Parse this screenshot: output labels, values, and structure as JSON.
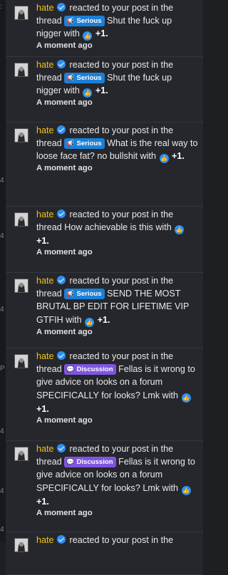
{
  "edge_chars": [
    ":",
    "4",
    "4",
    "4",
    "P",
    "4",
    "4",
    "4"
  ],
  "notifications": [
    {
      "user": "hate",
      "action": "reacted to your post in the thread",
      "tag": "Serious",
      "tag_type": "serious",
      "title": "Shut the fuck up nigger",
      "with": "with",
      "count": "+1.",
      "time": "A moment ago"
    },
    {
      "user": "hate",
      "action": "reacted to your post in the thread",
      "tag": "Serious",
      "tag_type": "serious",
      "title": "Shut the fuck up nigger",
      "with": "with",
      "count": "+1.",
      "time": "A moment ago"
    },
    {
      "user": "hate",
      "action": "reacted to your post in the thread",
      "tag": "Serious",
      "tag_type": "serious",
      "title": "What is the real way to loose face fat? no bullshit",
      "with": "with",
      "count": "+1.",
      "time": "A moment ago"
    },
    {
      "user": "hate",
      "action": "reacted to your post in the thread",
      "tag": "",
      "tag_type": "",
      "title": "How achievable is this",
      "with": "with",
      "count": "+1.",
      "time": "A moment ago"
    },
    {
      "user": "hate",
      "action": "reacted to your post in the thread",
      "tag": "Serious",
      "tag_type": "serious",
      "title": "SEND THE MOST BRUTAL BP EDIT FOR LIFETIME VIP GTFIH",
      "with": "with",
      "count": "+1.",
      "time": "A moment ago"
    },
    {
      "user": "hate",
      "action": "reacted to your post in the thread",
      "tag": "Discussion",
      "tag_type": "discussion",
      "title": "Fellas is it wrong to give advice on looks on a forum SPECIFICALLY for looks? Lmk",
      "with": "with",
      "count": "+1.",
      "time": "A moment ago"
    },
    {
      "user": "hate",
      "action": "reacted to your post in the thread",
      "tag": "Discussion",
      "tag_type": "discussion",
      "title": "Fellas is it wrong to give advice on looks on a forum SPECIFICALLY for looks? Lmk",
      "with": "with",
      "count": "+1.",
      "time": "A moment ago"
    },
    {
      "user": "hate",
      "action": "reacted to your post in the",
      "tag": "",
      "tag_type": "",
      "title": "",
      "with": "",
      "count": "",
      "time": ""
    }
  ]
}
